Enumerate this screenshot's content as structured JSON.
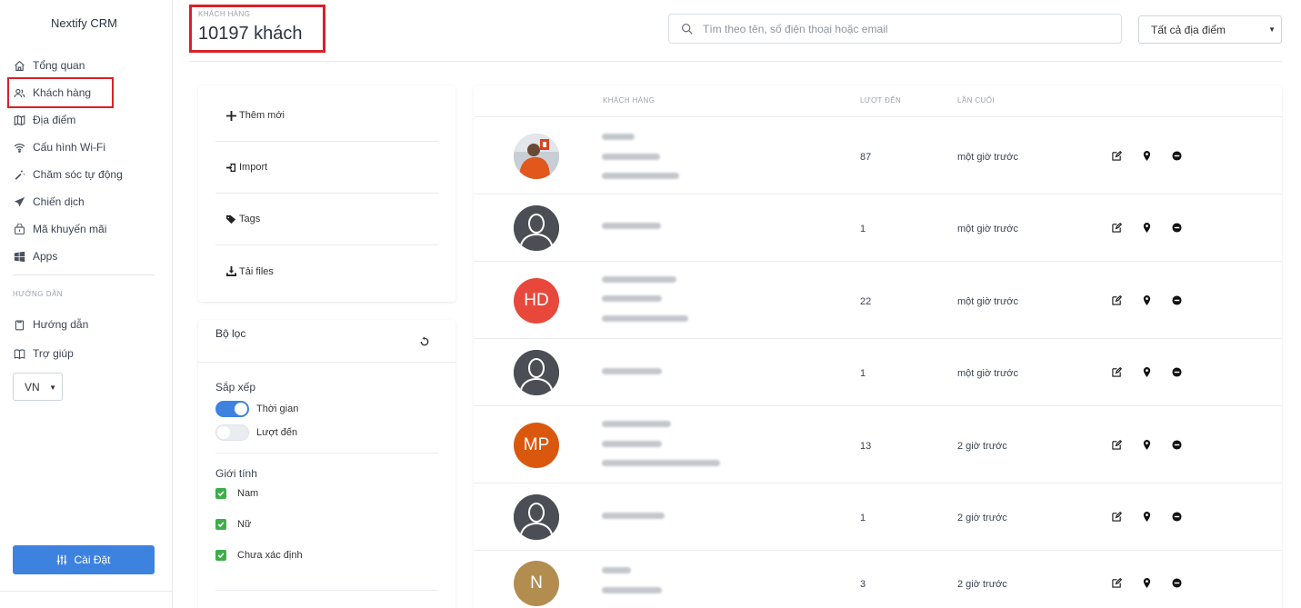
{
  "app": {
    "brand": "Nextify CRM"
  },
  "sidebar": {
    "items": [
      {
        "label": "Tổng quan",
        "icon": "home-icon"
      },
      {
        "label": "Khách hàng",
        "icon": "users-icon"
      },
      {
        "label": "Địa điểm",
        "icon": "map-icon"
      },
      {
        "label": "Cấu hình Wi-Fi",
        "icon": "wifi-icon"
      },
      {
        "label": "Chăm sóc tự động",
        "icon": "magic-wand-icon"
      },
      {
        "label": "Chiến dịch",
        "icon": "rocket-icon"
      },
      {
        "label": "Mã khuyến mãi",
        "icon": "ticket-icon"
      },
      {
        "label": "Apps",
        "icon": "windows-icon"
      }
    ],
    "section_label": "HƯỚNG DẪN",
    "guide_items": [
      {
        "label": "Hướng dẫn",
        "icon": "clipboard-icon"
      },
      {
        "label": "Trợ giúp",
        "icon": "book-icon"
      }
    ],
    "language": "VN",
    "settings_label": "Cài Đặt"
  },
  "header": {
    "label": "KHÁCH HÀNG",
    "count": "10197 khách",
    "search_placeholder": "Tìm theo tên, số điện thoại hoặc email",
    "location_selected": "Tất cả địa điểm"
  },
  "actions": [
    {
      "label": "Thêm mới",
      "icon": "plus-icon"
    },
    {
      "label": "Import",
      "icon": "import-icon"
    },
    {
      "label": "Tags",
      "icon": "tags-icon"
    },
    {
      "label": "Tải files",
      "icon": "download-icon"
    }
  ],
  "filter": {
    "title": "Bộ lọc",
    "sort_label": "Sắp xếp",
    "sort_options": [
      {
        "label": "Thời gian",
        "on": true
      },
      {
        "label": "Lượt đến",
        "on": false
      }
    ],
    "gender_label": "Giới tính",
    "gender_options": [
      {
        "label": "Nam",
        "checked": true
      },
      {
        "label": "Nữ",
        "checked": true
      },
      {
        "label": "Chưa xác định",
        "checked": true
      }
    ]
  },
  "table": {
    "headers": {
      "customer": "KHÁCH HÀNG",
      "visits": "LƯỢT ĐẾN",
      "last": "LẦN CUỐI"
    },
    "rows": [
      {
        "avatar_type": "photo",
        "initials": "",
        "avatar_color": "#c9cfd6",
        "visits": "87",
        "last": "một giờ trước"
      },
      {
        "avatar_type": "default",
        "initials": "",
        "avatar_color": "#4b4f55",
        "visits": "1",
        "last": "một giờ trước"
      },
      {
        "avatar_type": "initials",
        "initials": "HD",
        "avatar_color": "#e8483b",
        "visits": "22",
        "last": "một giờ trước"
      },
      {
        "avatar_type": "default",
        "initials": "",
        "avatar_color": "#4b4f55",
        "visits": "1",
        "last": "một giờ trước"
      },
      {
        "avatar_type": "initials",
        "initials": "MP",
        "avatar_color": "#d9580d",
        "visits": "13",
        "last": "2 giờ trước"
      },
      {
        "avatar_type": "default",
        "initials": "",
        "avatar_color": "#4b4f55",
        "visits": "1",
        "last": "2 giờ trước"
      },
      {
        "avatar_type": "initials",
        "initials": "N",
        "avatar_color": "#b38d50",
        "visits": "3",
        "last": "2 giờ trước"
      }
    ]
  },
  "colors": {
    "accent": "#3e82e0",
    "highlight": "#d9202a",
    "check": "#3fae4a"
  }
}
